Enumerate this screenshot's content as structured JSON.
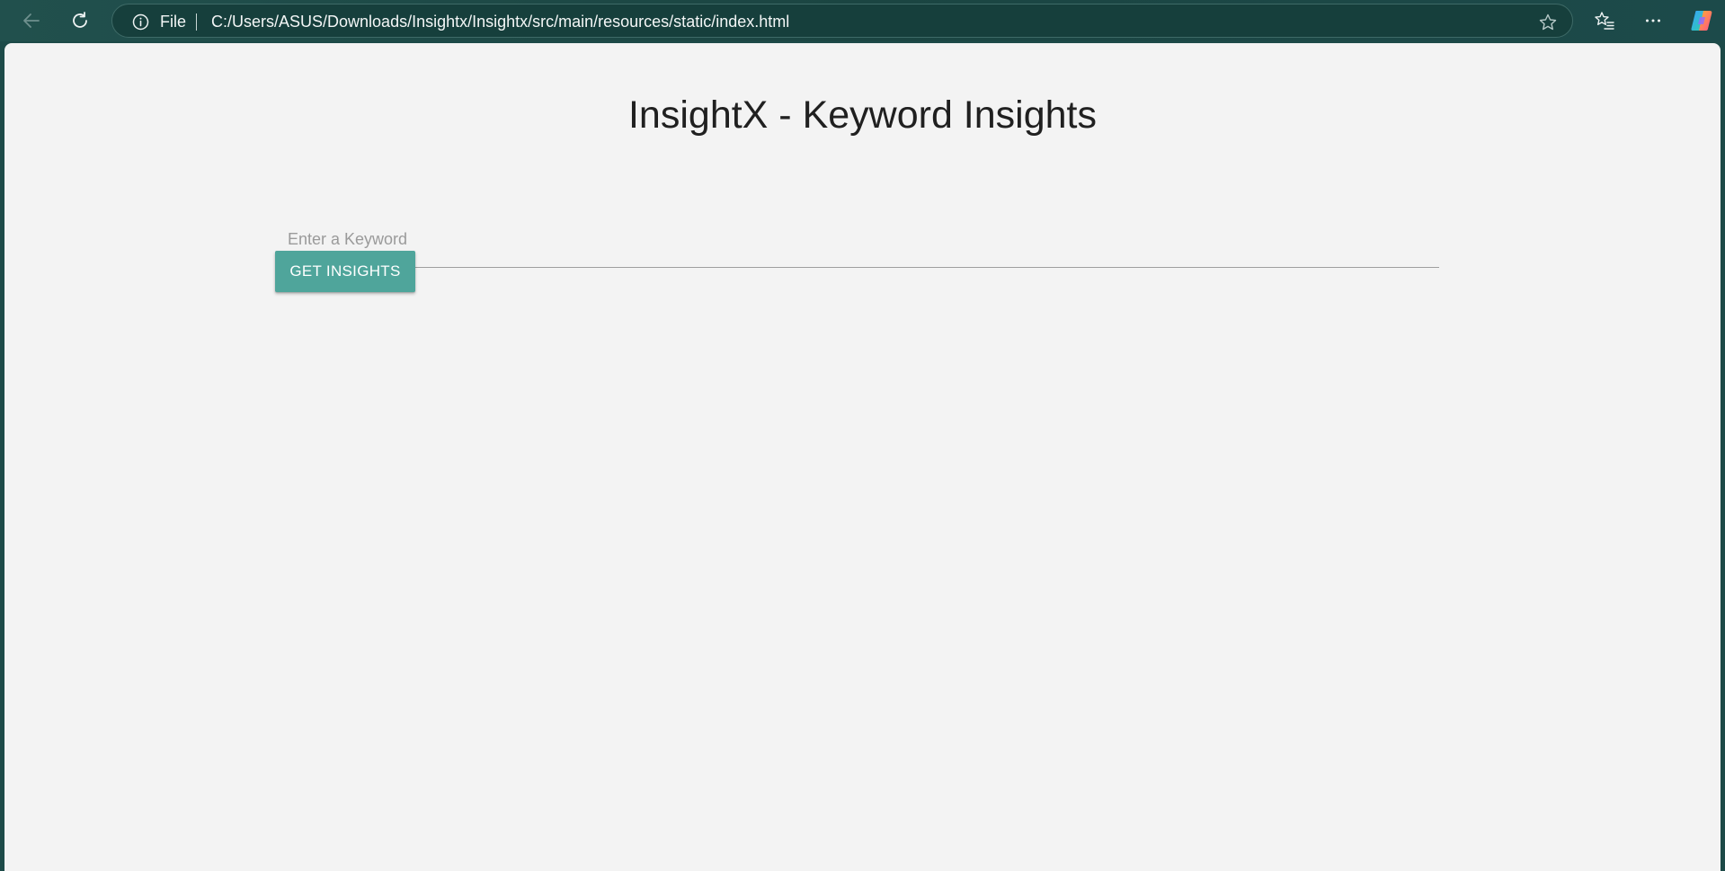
{
  "browser": {
    "back_icon": "arrow-left-icon",
    "refresh_icon": "refresh-icon",
    "address": {
      "info_icon": "info-icon",
      "scheme": "File",
      "url": "C:/Users/ASUS/Downloads/Insightx/Insightx/src/main/resources/static/index.html",
      "favorite_icon": "star-icon"
    },
    "toolbar": {
      "favorites_icon": "favorites-icon",
      "menu_icon": "more-icon",
      "copilot_icon": "copilot-icon"
    },
    "colors": {
      "chrome_bg": "#1d4a48",
      "address_bg": "#163f3c"
    }
  },
  "page": {
    "title": "InsightX - Keyword Insights",
    "keyword_input": {
      "placeholder": "Enter a Keyword",
      "value": ""
    },
    "submit_label": "GET INSIGHTS",
    "colors": {
      "background": "#f3f3f3",
      "accent": "#4fa59b",
      "title_text": "#202020"
    }
  }
}
